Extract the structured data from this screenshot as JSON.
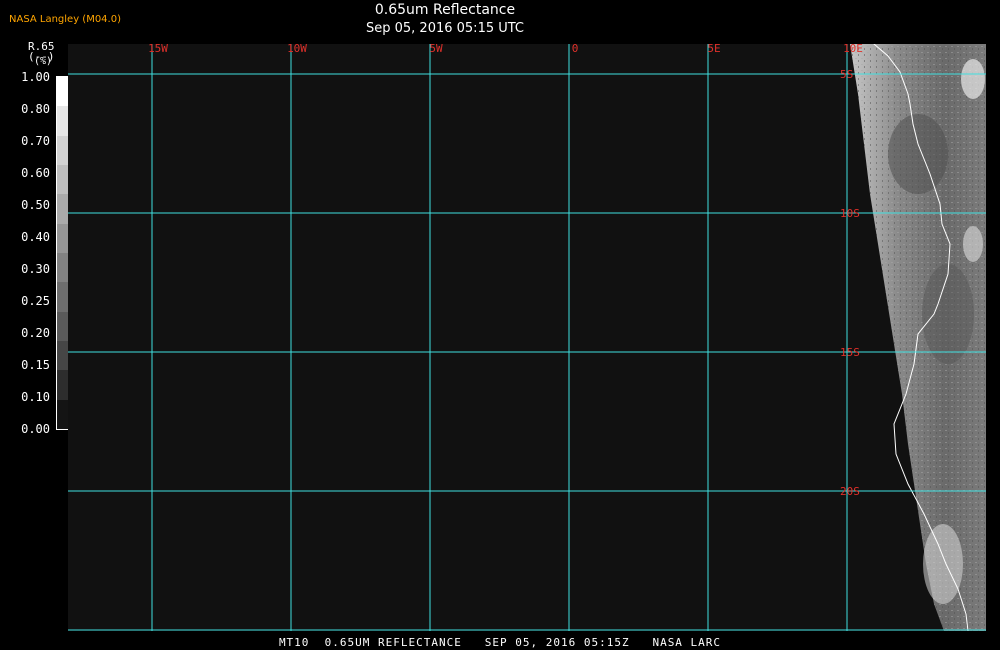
{
  "header": {
    "credit": "NASA Langley (M04.0)",
    "title": "0.65um Reflectance",
    "subtitle": "Sep 05, 2016 05:15 UTC"
  },
  "legend": {
    "title_line1": "R.65",
    "title_line2": "(--)",
    "unit": "(%)",
    "ticks": [
      "1.00",
      "0.80",
      "0.70",
      "0.60",
      "0.50",
      "0.40",
      "0.30",
      "0.25",
      "0.20",
      "0.15",
      "0.10",
      "0.00"
    ],
    "colors": [
      "#ffffff",
      "#e6e6e6",
      "#d2d2d2",
      "#bebebe",
      "#aaaaaa",
      "#969696",
      "#828282",
      "#6e6e6e",
      "#5a5a5a",
      "#464646",
      "#2d2d2d",
      "#141414"
    ]
  },
  "map": {
    "grid_color": "#40e0e0",
    "label_color": "#e0302a",
    "lon_labels": [
      "15W",
      "10W",
      "5W",
      "0",
      "5E",
      "10E"
    ],
    "lat_labels": [
      "5S",
      "10S",
      "15S",
      "20S"
    ]
  },
  "footer": {
    "text": "MT10  0.65UM REFLECTANCE   SEP 05, 2016 05:15Z   NASA LARC"
  }
}
